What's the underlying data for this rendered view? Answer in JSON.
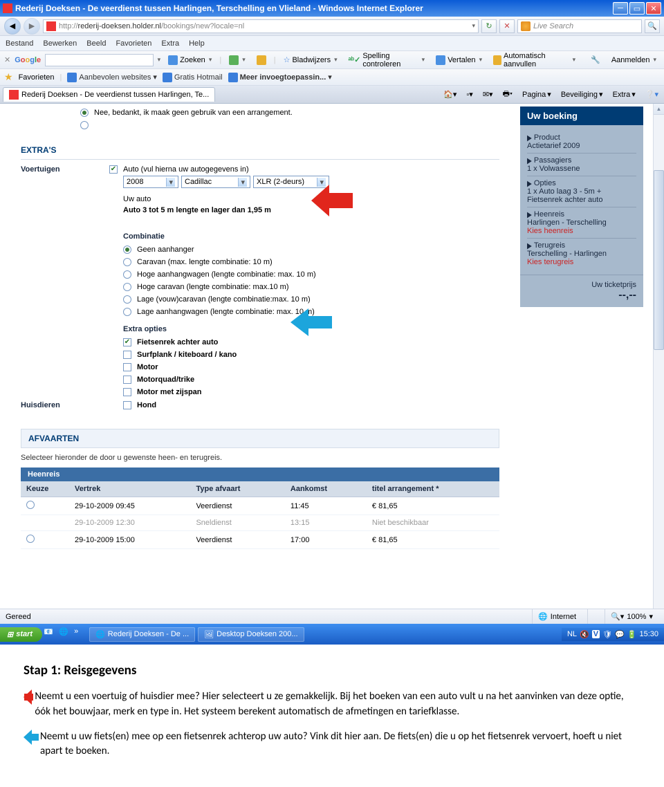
{
  "titlebar": {
    "title": "Rederij Doeksen - De veerdienst tussen Harlingen, Terschelling en Vlieland - Windows Internet Explorer"
  },
  "address": {
    "url_prefix": "http://",
    "url_mid": "rederij-doeksen.",
    "url_path": "/bookings/new?locale=nl",
    "search_placeholder": "Live Search"
  },
  "menu": [
    "Bestand",
    "Bewerken",
    "Beeld",
    "Favorieten",
    "Extra",
    "Help"
  ],
  "gtoolbar_items": [
    "Zoeken",
    "Bladwijzers",
    "Spelling controleren",
    "Vertalen",
    "Automatisch aanvullen"
  ],
  "gtoolbar_signin": "Aanmelden",
  "favbar": {
    "label": "Favorieten",
    "links": [
      "Aanbevolen websites",
      "Gratis Hotmail",
      "Meer invoegtoepassin..."
    ]
  },
  "tab": {
    "label": "Rederij Doeksen - De veerdienst tussen Harlingen, Te...",
    "right": [
      "Pagina",
      "Beveiliging",
      "Extra"
    ]
  },
  "form": {
    "arrangement_no": "Nee, bedankt, ik maak geen gebruik van een arrangement.",
    "extras_title": "EXTRA'S",
    "voertuigen_label": "Voertuigen",
    "auto_check": "Auto (vul hierna uw autogegevens in)",
    "year": "2008",
    "make": "Cadillac",
    "model": "XLR (2-deurs)",
    "uw_auto": "Uw auto",
    "auto_dims": "Auto 3 tot 5 m lengte en lager dan 1,95 m",
    "combi_title": "Combinatie",
    "combi_opts": [
      "Geen aanhanger",
      "Caravan (max. lengte combinatie: 10 m)",
      "Hoge aanhangwagen (lengte combinatie: max. 10 m)",
      "Hoge caravan (lengte combinatie: max.10 m)",
      "Lage (vouw)caravan (lengte combinatie:max. 10 m)",
      "Lage aanhangwagen (lengte combinatie: max. 10 m)"
    ],
    "extra_opties_title": "Extra opties",
    "extra_opts": [
      "Fietsenrek achter auto",
      "Surfplank / kiteboard / kano",
      "Motor",
      "Motorquad/trike",
      "Motor met zijspan"
    ],
    "huisdieren_label": "Huisdieren",
    "huisdieren_opt": "Hond"
  },
  "afvaarten": {
    "title": "AFVAARTEN",
    "sub": "Selecteer hieronder de door u gewenste heen- en terugreis.",
    "heen": "Heenreis",
    "cols": [
      "Keuze",
      "Vertrek",
      "Type afvaart",
      "Aankomst",
      "titel arrangement *"
    ],
    "rows": [
      {
        "vertrek": "29-10-2009 09:45",
        "type": "Veerdienst",
        "aank": "11:45",
        "prijs": "€ 81,65",
        "disabled": false
      },
      {
        "vertrek": "29-10-2009 12:30",
        "type": "Sneldienst",
        "aank": "13:15",
        "prijs": "Niet beschikbaar",
        "disabled": true
      },
      {
        "vertrek": "29-10-2009 15:00",
        "type": "Veerdienst",
        "aank": "17:00",
        "prijs": "€ 81,65",
        "disabled": false
      }
    ]
  },
  "sidebar": {
    "title": "Uw boeking",
    "product_l": "Product",
    "product_v": "Actietarief 2009",
    "pass_l": "Passagiers",
    "pass_v": "1 x Volwassene",
    "opt_l": "Opties",
    "opt_v": "1 x Auto laag 3 - 5m + Fietsenrek achter auto",
    "heen_l": "Heenreis",
    "heen_v": "Harlingen - Terschelling",
    "heen_k": "Kies heenreis",
    "terug_l": "Terugreis",
    "terug_v": "Terschelling - Harlingen",
    "terug_k": "Kies terugreis",
    "ticket_l": "Uw ticketprijs",
    "ticket_v": "--,--"
  },
  "statusbar": {
    "left": "Gereed",
    "internet": "Internet",
    "zoom": "100%"
  },
  "taskbar": {
    "start": "start",
    "btn1": "Rederij Doeksen - De ...",
    "btn2": "Desktop Doeksen 200...",
    "lang": "NL",
    "time": "15:30"
  },
  "doc": {
    "title": "Stap 1: Reisgegevens",
    "p1": "Neemt u een voertuig of huisdier mee? Hier selecteert u ze gemakkelijk. Bij het boeken van een auto vult u na het aanvinken van deze optie, óók het bouwjaar, merk en type in. Het systeem berekent automatisch de afmetingen en tariefklasse.",
    "p2": "Neemt u uw fiets(en) mee op een fietsenrek achterop uw auto? Vink dit hier aan. De fiets(en) die u op het fietsenrek vervoert, hoeft u niet apart te boeken."
  }
}
